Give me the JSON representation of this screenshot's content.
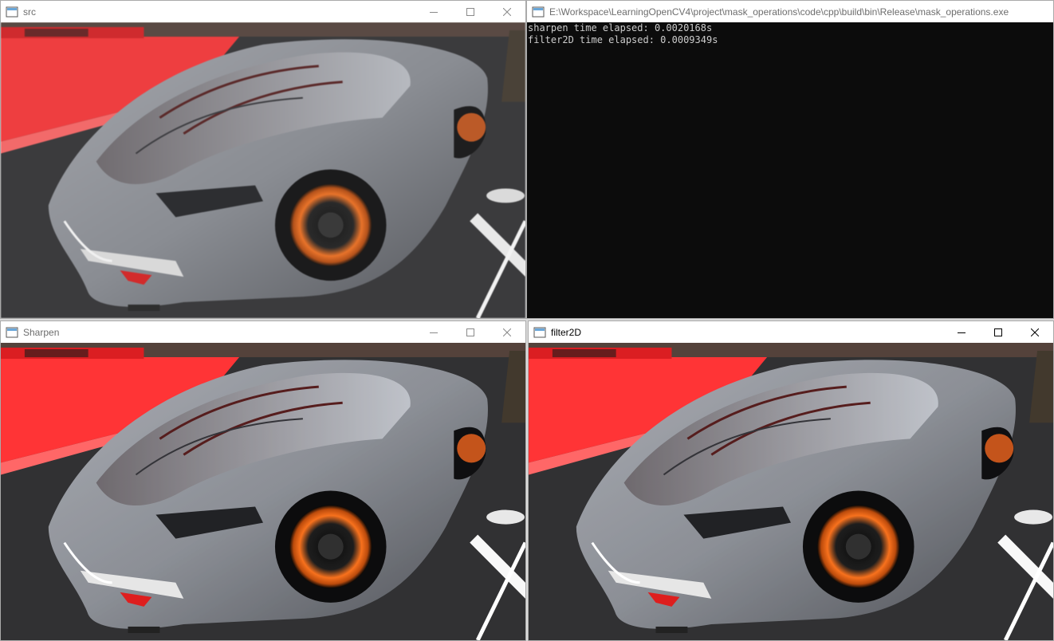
{
  "windows": {
    "src": {
      "title": "src"
    },
    "console": {
      "title": "E:\\Workspace\\LearningOpenCV4\\project\\mask_operations\\code\\cpp\\build\\bin\\Release\\mask_operations.exe",
      "lines": [
        "sharpen time elapsed: 0.0020168s",
        "filter2D time elapsed: 0.0009349s"
      ]
    },
    "sharpen": {
      "title": "Sharpen"
    },
    "filter2d": {
      "title": "filter2D"
    }
  },
  "icons": {
    "window_icon": "app-window-icon",
    "minimize": "minimize-icon",
    "maximize": "maximize-icon",
    "close": "close-icon"
  },
  "colors": {
    "console_bg": "#0c0c0c",
    "console_text": "#cccccc",
    "carpet_red": "#ef3b3d",
    "car_gray": "#8c8f95",
    "wheel_orange": "#e8732a"
  }
}
